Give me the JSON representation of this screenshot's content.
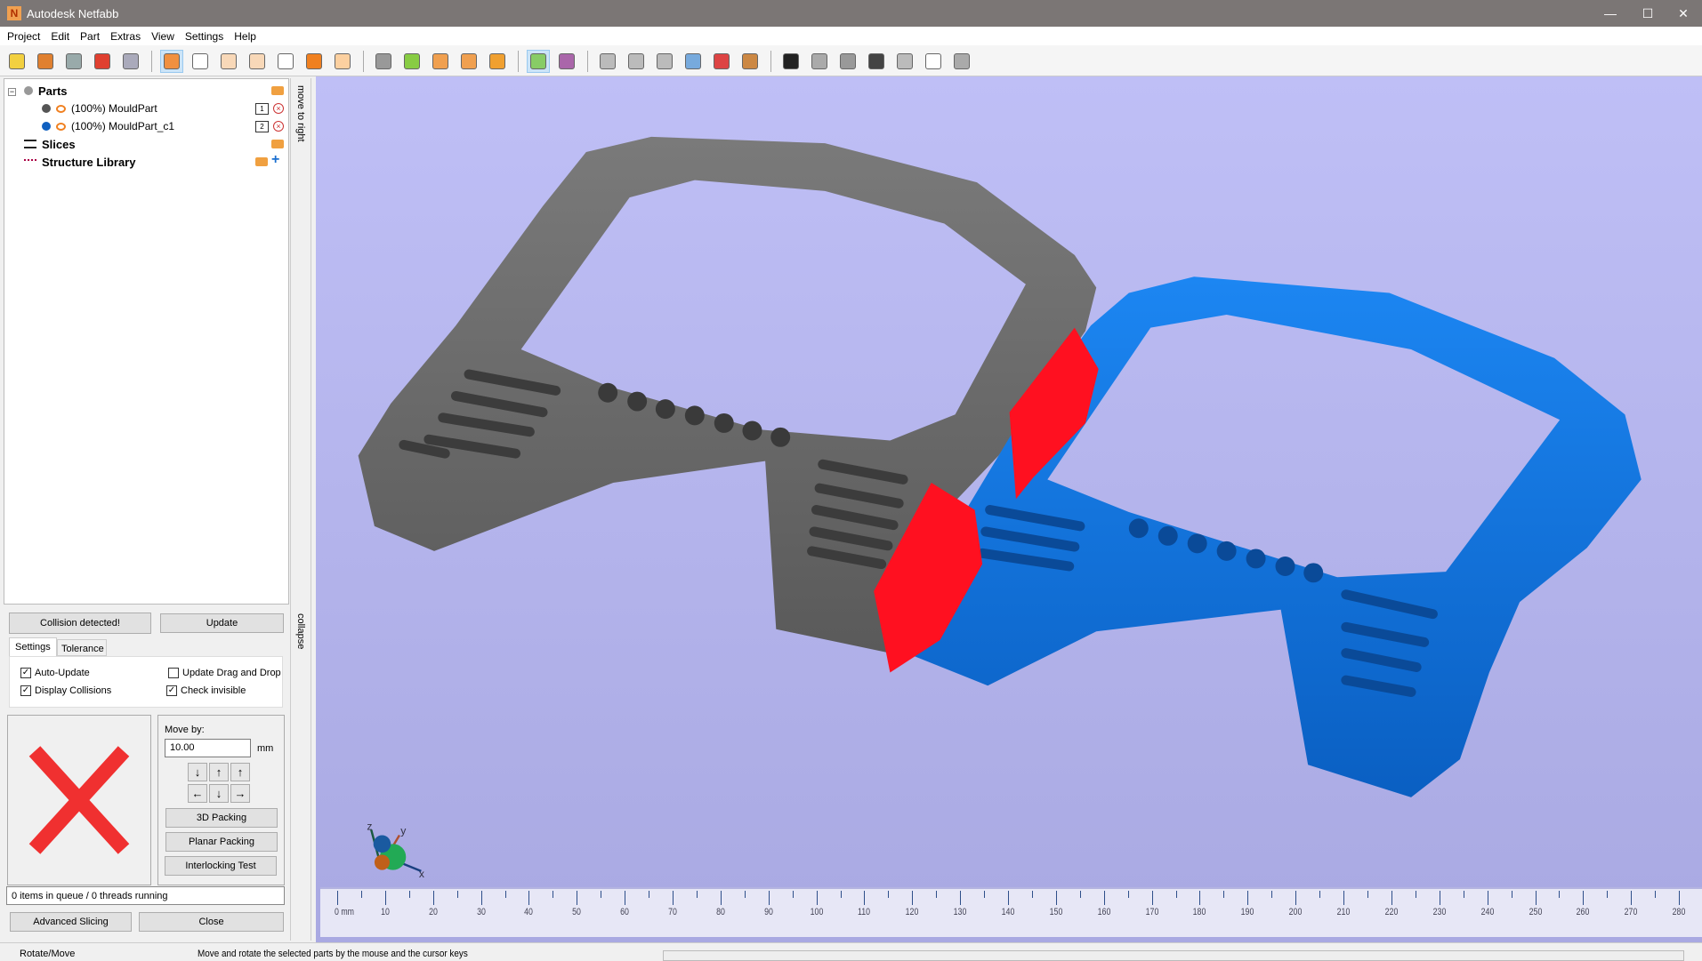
{
  "window": {
    "title": "Autodesk Netfabb",
    "logo_letter": "N",
    "minimize": "—",
    "maximize": "☐",
    "close": "✕"
  },
  "menu": [
    "Project",
    "Edit",
    "Part",
    "Extras",
    "View",
    "Settings",
    "Help"
  ],
  "toolbar": [
    {
      "icon": "open-project-icon",
      "color": "#f2d040"
    },
    {
      "icon": "add-part-icon",
      "color": "#e08030"
    },
    {
      "icon": "part-info-icon",
      "color": "#9aa"
    },
    {
      "icon": "add-part-plus-icon",
      "color": "#e04030"
    },
    {
      "icon": "add-box-icon",
      "color": "#aab"
    },
    {
      "sep": true
    },
    {
      "icon": "view-default-icon",
      "color": "#f09040",
      "active": true
    },
    {
      "icon": "view-front-icon",
      "color": "#fff"
    },
    {
      "icon": "view-back-icon",
      "color": "#f8d8b8"
    },
    {
      "icon": "view-left-icon",
      "color": "#f8d8b8"
    },
    {
      "icon": "view-right-icon",
      "color": "#fff"
    },
    {
      "icon": "view-top-icon",
      "color": "#f08020"
    },
    {
      "icon": "view-bottom-icon",
      "color": "#fcd0a0"
    },
    {
      "sep": true
    },
    {
      "icon": "select-parts-icon",
      "color": "#999"
    },
    {
      "icon": "select-all-icon",
      "color": "#8c4"
    },
    {
      "icon": "zoom-box-icon",
      "color": "#f0a050"
    },
    {
      "icon": "zoom-selected-icon",
      "color": "#f0a050"
    },
    {
      "icon": "magnifier-icon",
      "color": "#f0a030"
    },
    {
      "sep": true
    },
    {
      "icon": "pointer-icon",
      "color": "#8c6",
      "active": true
    },
    {
      "icon": "coordinate-system-icon",
      "color": "#a6a"
    },
    {
      "sep": true
    },
    {
      "icon": "move-part-icon",
      "color": "#bbb"
    },
    {
      "icon": "rotate-part-icon",
      "color": "#bbb"
    },
    {
      "icon": "scale-part-icon",
      "color": "#bbb"
    },
    {
      "icon": "mesh-icon",
      "color": "#7ad"
    },
    {
      "icon": "boolean-icon",
      "color": "#d44"
    },
    {
      "icon": "section-icon",
      "color": "#c84"
    },
    {
      "sep": true
    },
    {
      "icon": "add-icon",
      "color": "#222"
    },
    {
      "icon": "shell-icon",
      "color": "#aaa"
    },
    {
      "icon": "ruler-icon",
      "color": "#999"
    },
    {
      "icon": "support-icon",
      "color": "#444"
    },
    {
      "icon": "surface-icon",
      "color": "#bbb"
    },
    {
      "icon": "label-abc-icon",
      "color": "#fff"
    },
    {
      "icon": "cylinder-icon",
      "color": "#aaa"
    }
  ],
  "tree": {
    "parts_label": "Parts",
    "parts": [
      {
        "label": "(100%) MouldPart",
        "color": "#555555",
        "num": "1"
      },
      {
        "label": "(100%) MouldPart_c1",
        "color": "#1060c0",
        "num": "2"
      }
    ],
    "slices_label": "Slices",
    "structure_label": "Structure Library"
  },
  "side_tabs": {
    "move_to_right": "move to right",
    "collapse": "collapse"
  },
  "collision": {
    "status_button": "Collision detected!",
    "update_button": "Update",
    "tabs": [
      "Settings",
      "Tolerance"
    ],
    "checks": [
      {
        "label": "Auto-Update",
        "checked": true
      },
      {
        "label": "Display Collisions",
        "checked": true
      },
      {
        "label": "Update Drag and Drop",
        "checked": false
      },
      {
        "label": "Check invisible",
        "checked": true
      }
    ],
    "status_color": "#f03030",
    "move_by_label": "Move by:",
    "move_by_value": "10.00",
    "unit": "mm",
    "packing_3d": "3D Packing",
    "planar_packing": "Planar Packing",
    "interlocking": "Interlocking Test",
    "queue": "0 items in queue / 0 threads running",
    "advanced_slicing": "Advanced Slicing",
    "close": "Close"
  },
  "viewport": {
    "axis_x": "x",
    "axis_y": "y",
    "axis_z": "z",
    "part_colors": {
      "part1": "#6b6b6b",
      "part2": "#1a78e0",
      "collision": "#ff1020"
    }
  },
  "ruler": {
    "labels": [
      "0 mm",
      "10",
      "20",
      "30",
      "40",
      "50",
      "60",
      "70",
      "80",
      "90",
      "100",
      "110",
      "120",
      "130",
      "140",
      "150",
      "160",
      "170",
      "180",
      "190",
      "200",
      "210",
      "220",
      "230",
      "240",
      "250",
      "260",
      "270",
      "280"
    ]
  },
  "status": {
    "mode": "Rotate/Move",
    "hint": "Move and rotate the selected parts by the mouse and the cursor keys"
  }
}
